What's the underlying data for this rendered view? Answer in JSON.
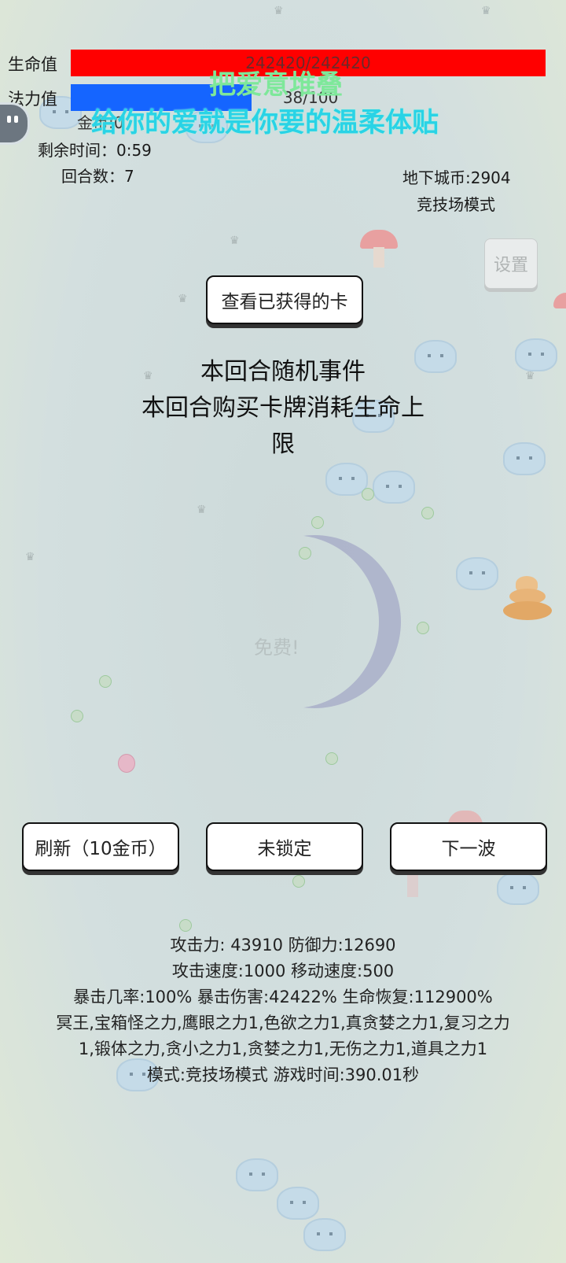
{
  "hud": {
    "hp_label": "生命值",
    "hp_value": "242420/242420",
    "hp_fraction": 1.0,
    "mp_label": "法力值",
    "mp_value": "38/100",
    "mp_fraction": 0.38,
    "gold_text": "金币:0",
    "time_left": "剩余时间：0:59",
    "round": "回合数：7",
    "dungeon_coins": "地下城币:2904",
    "mode": "竞技场模式"
  },
  "overlay": {
    "line1": "把爱意堆叠",
    "line2": "给你的爱就是你要的温柔体贴"
  },
  "buttons": {
    "settings": "设置",
    "view_cards": "查看已获得的卡",
    "refresh": "刷新（10金币）",
    "lock": "未锁定",
    "next_wave": "下一波"
  },
  "event": {
    "title": "本回合随机事件",
    "line1": "本回合购买卡牌消耗生命上",
    "line2": "限"
  },
  "center_faded": "免费!",
  "stats": {
    "line1": "攻击力: 43910 防御力:12690",
    "line2": "攻击速度:1000 移动速度:500",
    "line3": "暴击几率:100% 暴击伤害:42422% 生命恢复:112900%",
    "line4": "冥王,宝箱怪之力,鹰眼之力1,色欲之力1,真贪婪之力1,复习之力",
    "line5": "1,锻体之力,贪小之力1,贪婪之力1,无伤之力1,道具之力1",
    "line6": "模式:竞技场模式 游戏时间:390.01秒"
  },
  "colors": {
    "hp_bar": "#ff0000",
    "mp_bar": "#1565ff",
    "overlay_green": "#7ee89a",
    "overlay_cyan": "#29d3e6",
    "background": "#d3dfdf"
  },
  "icons": [
    "avatar-icon",
    "slime-icon",
    "crown-icon",
    "mushroom-icon",
    "poop-icon",
    "potion-icon",
    "crescent-icon"
  ]
}
